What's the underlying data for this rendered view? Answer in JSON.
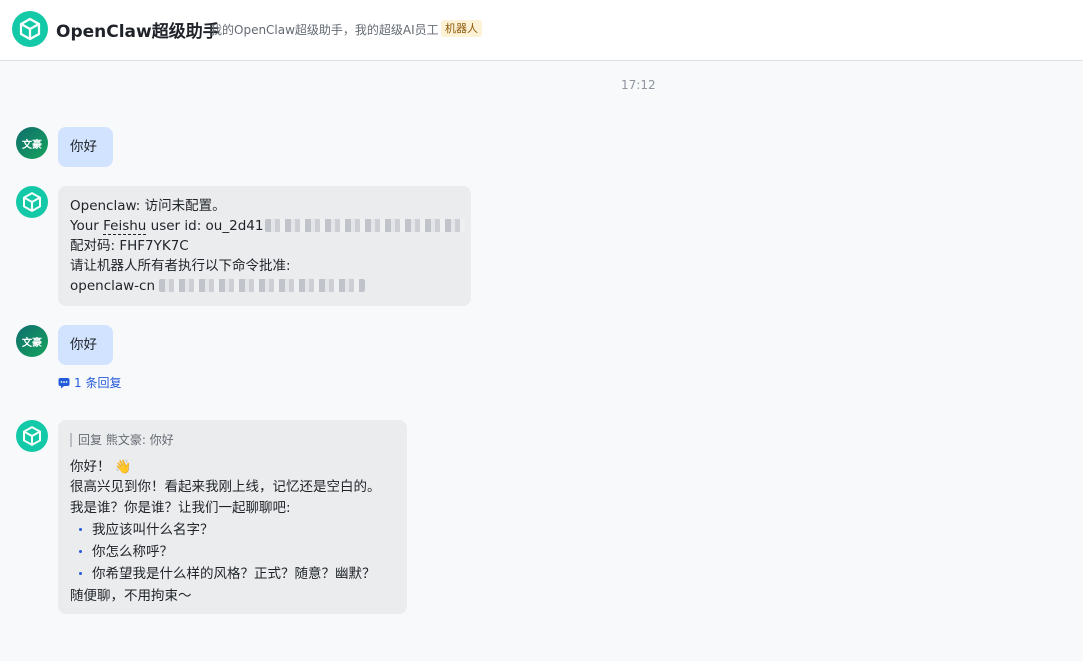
{
  "header": {
    "title": "OpenClaw超级助手",
    "description": "我的OpenClaw超级助手，我的超级AI员工",
    "badge": "机器人",
    "accent": "#14c9a8"
  },
  "chat": {
    "time_separator": "17:12",
    "user_avatar_text": "文豪",
    "msg1": {
      "text": "你好"
    },
    "msg2": {
      "line1": "Openclaw: 访问未配置。",
      "line2_prefix": "Your ",
      "line2_feishu": "Feishu",
      "line2_mid": " user id: ou_2d41",
      "line3": "配对码: FHF7YK7C",
      "line4": "请让机器人所有者执行以下命令批准:",
      "line5_prefix": "openclaw-cn "
    },
    "msg3": {
      "text": "你好",
      "reply_count": "1 条回复"
    },
    "msg4": {
      "quote": "回复 熊文豪: 你好",
      "greeting": "你好！",
      "greeting_emoji": "👋",
      "line1": "很高兴见到你！看起来我刚上线，记忆还是空白的。",
      "line2": "我是谁？你是谁？让我们一起聊聊吧:",
      "bullets": [
        "我应该叫什么名字？",
        "你怎么称呼？",
        "你希望我是什么样的风格？正式？随意？幽默？"
      ],
      "closing": "随便聊，不用拘束～"
    }
  }
}
